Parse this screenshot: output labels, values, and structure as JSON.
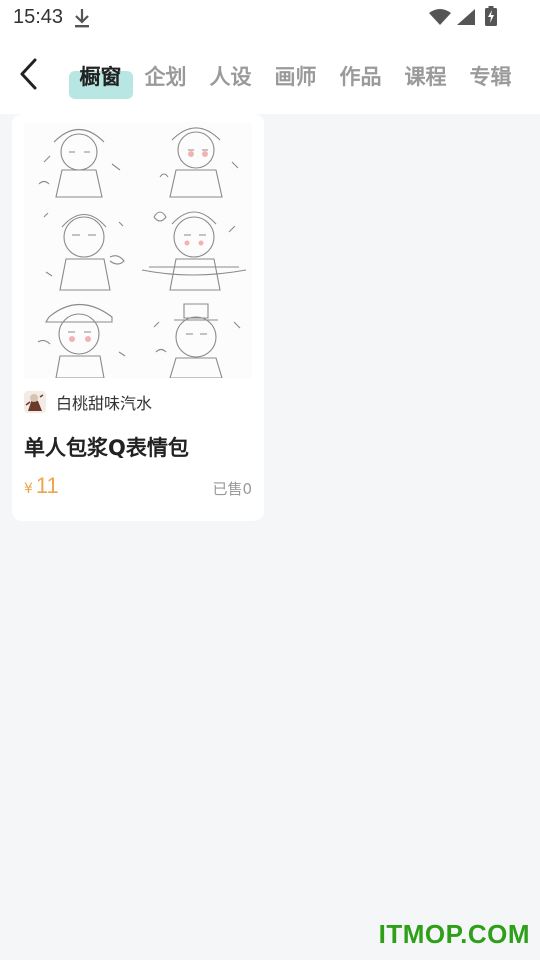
{
  "status_bar": {
    "time": "15:43"
  },
  "tabs": [
    {
      "label": "橱窗",
      "active": true
    },
    {
      "label": "企划",
      "active": false
    },
    {
      "label": "人设",
      "active": false
    },
    {
      "label": "画师",
      "active": false
    },
    {
      "label": "作品",
      "active": false
    },
    {
      "label": "课程",
      "active": false
    },
    {
      "label": "专辑",
      "active": false
    }
  ],
  "product": {
    "author": "白桃甜味汽水",
    "title": "单人包浆Q表情包",
    "price_symbol": "¥",
    "price": "11",
    "sold": "已售0"
  },
  "watermark": "ITMOP.COM",
  "colors": {
    "accent": "#b8e6e2",
    "price": "#f0a34a",
    "watermark": "#2e9f18"
  }
}
